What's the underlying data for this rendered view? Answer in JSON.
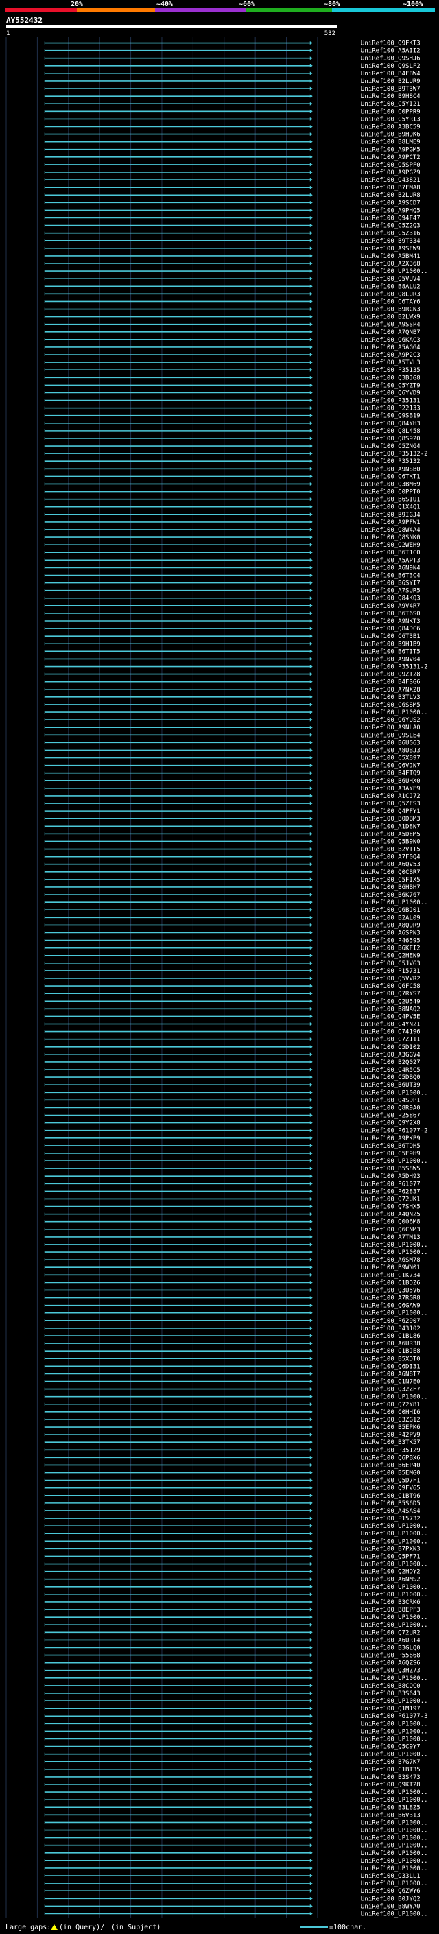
{
  "title": "AY552432",
  "scale_start": "1",
  "scale_end": "532",
  "colorbar": {
    "ticks": [
      "20%",
      "~40%",
      "~60%",
      "~80%",
      "~100%"
    ],
    "colors": [
      "#e8102a",
      "#ff7a00",
      "#9b30d0",
      "#1fae1f",
      "#19c8d8"
    ]
  },
  "footer": {
    "large_gaps": "Large gaps:",
    "in_query": "(in Query)/",
    "in_subject": "(in Subject)",
    "scale_label": "=100char."
  },
  "colors": {
    "hit": "#4cc8d8",
    "grid": "#1f2f4a",
    "text": "#ffffff",
    "green": "#1fae1f"
  },
  "chart_data": {
    "type": "alignment",
    "query_length": 532,
    "hits": [
      "UniRef100_Q9FKT3",
      "UniRef100_A5AII2",
      "UniRef100_Q9SHJ6",
      "UniRef100_Q9SLF2",
      "UniRef100_B4FBW4",
      "UniRef100_B2LUR9",
      "UniRef100_B9T3W7",
      "UniRef100_B9H8C4",
      "UniRef100_C5YI21",
      "UniRef100_C0PPR9",
      "UniRef100_C5YRI3",
      "UniRef100_A3BC59",
      "UniRef100_B9HDK6",
      "UniRef100_B8LME9",
      "UniRef100_A9PGM5",
      "UniRef100_A9PCT2",
      "UniRef100_Q5SPF0",
      "UniRef100_A9PGZ9",
      "UniRef100_Q43821",
      "UniRef100_B7FMA8",
      "UniRef100_B2LUR8",
      "UniRef100_A9SCD7",
      "UniRef100_A9PHQ5",
      "UniRef100_Q94F47",
      "UniRef100_C5Z2Q3",
      "UniRef100_C5Z316",
      "UniRef100_B9T334",
      "UniRef100_A9SEW9",
      "UniRef100_A5BM41",
      "UniRef100_A2X368",
      "UniRef100_UP1000..",
      "UniRef100_Q5VUV4",
      "UniRef100_B8ALU2",
      "UniRef100_Q8LUR3",
      "UniRef100_C6TAY6",
      "UniRef100_B9RCN3",
      "UniRef100_B2LWX9",
      "UniRef100_A9SSP4",
      "UniRef100_A7QNB7",
      "UniRef100_Q6KAC3",
      "UniRef100_A5AGG4",
      "UniRef100_A9P2C3",
      "UniRef100_A5TVL3",
      "UniRef100_P35135",
      "UniRef100_Q3BJG8",
      "UniRef100_C5YZT9",
      "UniRef100_Q6YVD9",
      "UniRef100_P35131",
      "UniRef100_P22133",
      "UniRef100_Q9SB19",
      "UniRef100_Q84YH3",
      "UniRef100_Q8L458",
      "UniRef100_Q8S920",
      "UniRef100_C5ZNG4",
      "UniRef100_P35132-2",
      "UniRef100_P35132",
      "UniRef100_A9NSB0",
      "UniRef100_C6TKT1",
      "UniRef100_Q3BM69",
      "UniRef100_C0PPT0",
      "UniRef100_B6SIU1",
      "UniRef100_Q1X4Q1",
      "UniRef100_B9IGJ4",
      "UniRef100_A9PFW1",
      "UniRef100_Q8W4A4",
      "UniRef100_Q8SNK0",
      "UniRef100_Q2WEH9",
      "UniRef100_B6T1C0",
      "UniRef100_A5APT3",
      "UniRef100_A6N9N4",
      "UniRef100_B6T3C4",
      "UniRef100_B6SYI7",
      "UniRef100_A7SUR5",
      "UniRef100_Q84KQ3",
      "UniRef100_A9V4R7",
      "UniRef100_B6T6S0",
      "UniRef100_A9NKT3",
      "UniRef100_Q84DC6",
      "UniRef100_C6T3B1",
      "UniRef100_B9H1B9",
      "UniRef100_B6TIT5",
      "UniRef100_A9NV04",
      "UniRef100_P35131-2",
      "UniRef100_Q9ZT28",
      "UniRef100_B4FSG6",
      "UniRef100_A7NX28",
      "UniRef100_B3TLV3",
      "UniRef100_C6SSM5",
      "UniRef100_UP1000..",
      "UniRef100_Q6YUS2",
      "UniRef100_A9NLA0",
      "UniRef100_Q9SLE4",
      "UniRef100_B6UG63",
      "UniRef100_A8UBJ3",
      "UniRef100_C5X897",
      "UniRef100_Q6VJN7",
      "UniRef100_B4FTQ9",
      "UniRef100_B6UHX0",
      "UniRef100_A3AYE9",
      "UniRef100_A1CJ72",
      "UniRef100_Q5ZFS3",
      "UniRef100_Q4PFY1",
      "UniRef100_B0DBM3",
      "UniRef100_A1D8N7",
      "UniRef100_A5DEM5",
      "UniRef100_Q5B9N0",
      "UniRef100_B2VTT5",
      "UniRef100_A7F0Q4",
      "UniRef100_A6QV53",
      "UniRef100_Q0CBR7",
      "UniRef100_C5FIX5",
      "UniRef100_B6HBH7",
      "UniRef100_B6K767",
      "UniRef100_UP1000..",
      "UniRef100_Q6BJ01",
      "UniRef100_B2AL09",
      "UniRef100_A8Q9R9",
      "UniRef100_A6SPN3",
      "UniRef100_P46595",
      "UniRef100_B6KFI2",
      "UniRef100_Q2HEN9",
      "UniRef100_C5JVG3",
      "UniRef100_P15731",
      "UniRef100_Q5VVR2",
      "UniRef100_Q6FC58",
      "UniRef100_Q7RYS7",
      "UniRef100_Q2U549",
      "UniRef100_B8NAQ2",
      "UniRef100_Q4PV5E",
      "UniRef100_C4YN21",
      "UniRef100_O74196",
      "UniRef100_C7Z111",
      "UniRef100_C5DI02",
      "UniRef100_A3GGV4",
      "UniRef100_B2Q027",
      "UniRef100_C4R5C5",
      "UniRef100_C5DBQ0",
      "UniRef100_B6UT39",
      "UniRef100_UP1000..",
      "UniRef100_Q4SDP1",
      "UniRef100_Q8R9A0",
      "UniRef100_P25867",
      "UniRef100_Q9Y2X8",
      "UniRef100_P61077-2",
      "UniRef100_A9PKP9",
      "UniRef100_B6TDH5",
      "UniRef100_C5E9H9",
      "UniRef100_UP1000..",
      "UniRef100_B5S8W5",
      "UniRef100_A5DH93",
      "UniRef100_P61077",
      "UniRef100_P62837",
      "UniRef100_Q72UK1",
      "UniRef100_Q7SHX5",
      "UniRef100_A4QN25",
      "UniRef100_Q006M8",
      "UniRef100_Q6CNM3",
      "UniRef100_A7TM13",
      "UniRef100_UP1000..",
      "UniRef100_UP1000..",
      "UniRef100_A6SM78",
      "UniRef100_B9WN01",
      "UniRef100_C1K734",
      "UniRef100_C1BDZ6",
      "UniRef100_Q3U5V6",
      "UniRef100_A7RGR8",
      "UniRef100_Q6GAW9",
      "UniRef100_UP1000..",
      "UniRef100_P62907",
      "UniRef100_P43102",
      "UniRef100_C1BL86",
      "UniRef100_A6UR38",
      "UniRef100_C1BJE8",
      "UniRef100_B5XDT0",
      "UniRef100_Q6DI31",
      "UniRef100_A6N8T7",
      "UniRef100_C1N7E0",
      "UniRef100_Q32ZF7",
      "UniRef100_UP1000..",
      "UniRef100_Q72Y81",
      "UniRef100_C0HHI6",
      "UniRef100_C3ZG12",
      "UniRef100_B5EPK6",
      "UniRef100_P42PV9",
      "UniRef100_B3TK57",
      "UniRef100_P35129",
      "UniRef100_Q6PBX6",
      "UniRef100_B6EP40",
      "UniRef100_B5EMG0",
      "UniRef100_Q5D7F1",
      "UniRef100_Q9FV65",
      "UniRef100_C1BT96",
      "UniRef100_B5S6D5",
      "UniRef100_A4SAS4",
      "UniRef100_P15732",
      "UniRef100_UP1000..",
      "UniRef100_UP1000..",
      "UniRef100_UP1000..",
      "UniRef100_B7PXN3",
      "UniRef100_Q5PF71",
      "UniRef100_UP1000..",
      "UniRef100_Q2HDY2",
      "UniRef100_A6NMS2",
      "UniRef100_UP1000..",
      "UniRef100_UP1000..",
      "UniRef100_B3CRK6",
      "UniRef100_B8EPF3",
      "UniRef100_UP1000..",
      "UniRef100_UP1000..",
      "UniRef100_Q72UR2",
      "UniRef100_A6URT4",
      "UniRef100_B3GLQ0",
      "UniRef100_P55668",
      "UniRef100_A6QZS6",
      "UniRef100_Q3HZ73",
      "UniRef100_UP1000..",
      "UniRef100_B8COC0",
      "UniRef100_B3S643",
      "UniRef100_UP1000..",
      "UniRef100_Q1M197",
      "UniRef100_P61077-3",
      "UniRef100_UP1000..",
      "UniRef100_UP1000..",
      "UniRef100_UP1000..",
      "UniRef100_Q5C9Y7",
      "UniRef100_UP1000..",
      "UniRef100_B7G7K7",
      "UniRef100_C1BT35",
      "UniRef100_B3S473",
      "UniRef100_Q9KT28",
      "UniRef100_UP1000..",
      "UniRef100_UP1000..",
      "UniRef100_B3L8Z5",
      "UniRef100_B6V313",
      "UniRef100_UP1000..",
      "UniRef100_UP1000..",
      "UniRef100_UP1000..",
      "UniRef100_UP1000..",
      "UniRef100_UP1000..",
      "UniRef100_UP1000..",
      "UniRef100_UP1000..",
      "UniRef100_Q33LL1",
      "UniRef100_UP1000..",
      "UniRef100_Q6ZWY6",
      "UniRef100_B0JYQ2",
      "UniRef100_B8WYA0",
      "UniRef100_UP1000.."
    ]
  }
}
